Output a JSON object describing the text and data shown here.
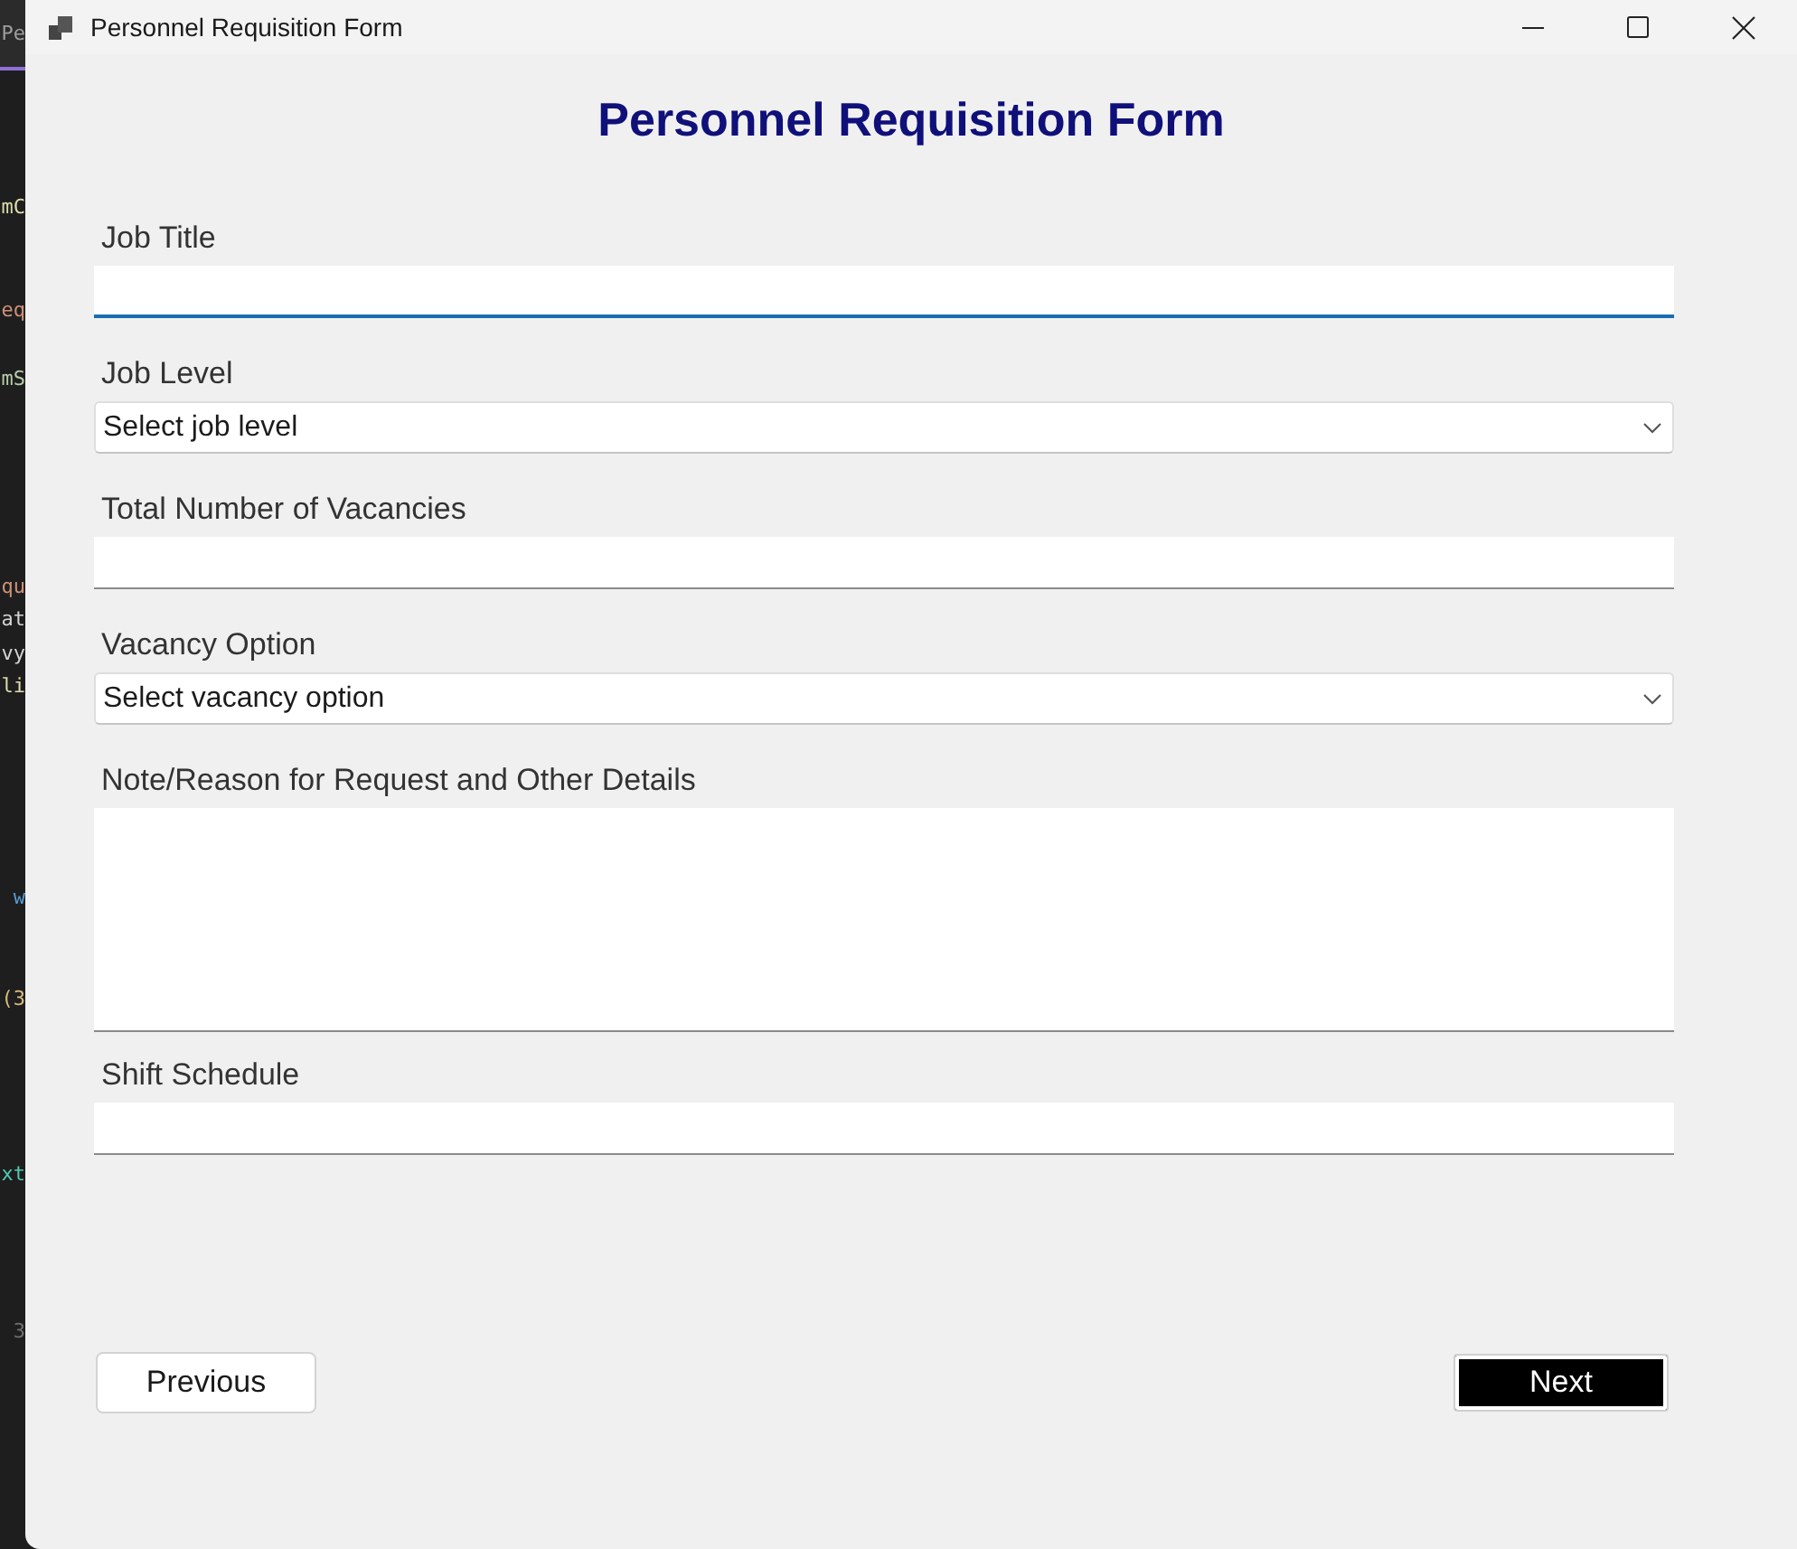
{
  "background_editor": {
    "tab_label": "Pe",
    "code_fragments": [
      {
        "text": "mC",
        "color": "#dcdcaa"
      },
      {
        "text": "eq",
        "color": "#ce9178"
      },
      {
        "text": "mS",
        "color": "#b5cea8"
      },
      {
        "text": "qu",
        "color": "#ce9178"
      },
      {
        "text": "at",
        "color": "#d4d4d4"
      },
      {
        "text": "vy",
        "color": "#d4d4d4"
      },
      {
        "text": "li",
        "color": "#dcdcaa"
      },
      {
        "text": "w",
        "color": "#569cd6"
      },
      {
        "text": "(3",
        "color": "#d7ba7d"
      },
      {
        "text": "xt",
        "color": "#4ec9b0"
      },
      {
        "text": "3",
        "color": "#6e6e6e"
      }
    ]
  },
  "window": {
    "title": "Personnel Requisition Form"
  },
  "form": {
    "heading": "Personnel Requisition Form",
    "fields": [
      {
        "kind": "text",
        "label": "Job Title",
        "focused": true
      },
      {
        "kind": "dropdown",
        "label": "Job Level",
        "placeholder": "Select job level",
        "focused": false
      },
      {
        "kind": "text",
        "label": "Total Number of Vacancies",
        "focused": false
      },
      {
        "kind": "dropdown",
        "label": "Vacancy Option",
        "placeholder": "Select vacancy option",
        "focused": false
      },
      {
        "kind": "textarea",
        "label": "Note/Reason for Request and Other Details",
        "focused": false
      },
      {
        "kind": "text",
        "label": "Shift Schedule",
        "focused": false
      }
    ]
  },
  "buttons": [
    {
      "kind": "previous",
      "label": "Previous"
    },
    {
      "kind": "next",
      "label": "Next"
    }
  ]
}
